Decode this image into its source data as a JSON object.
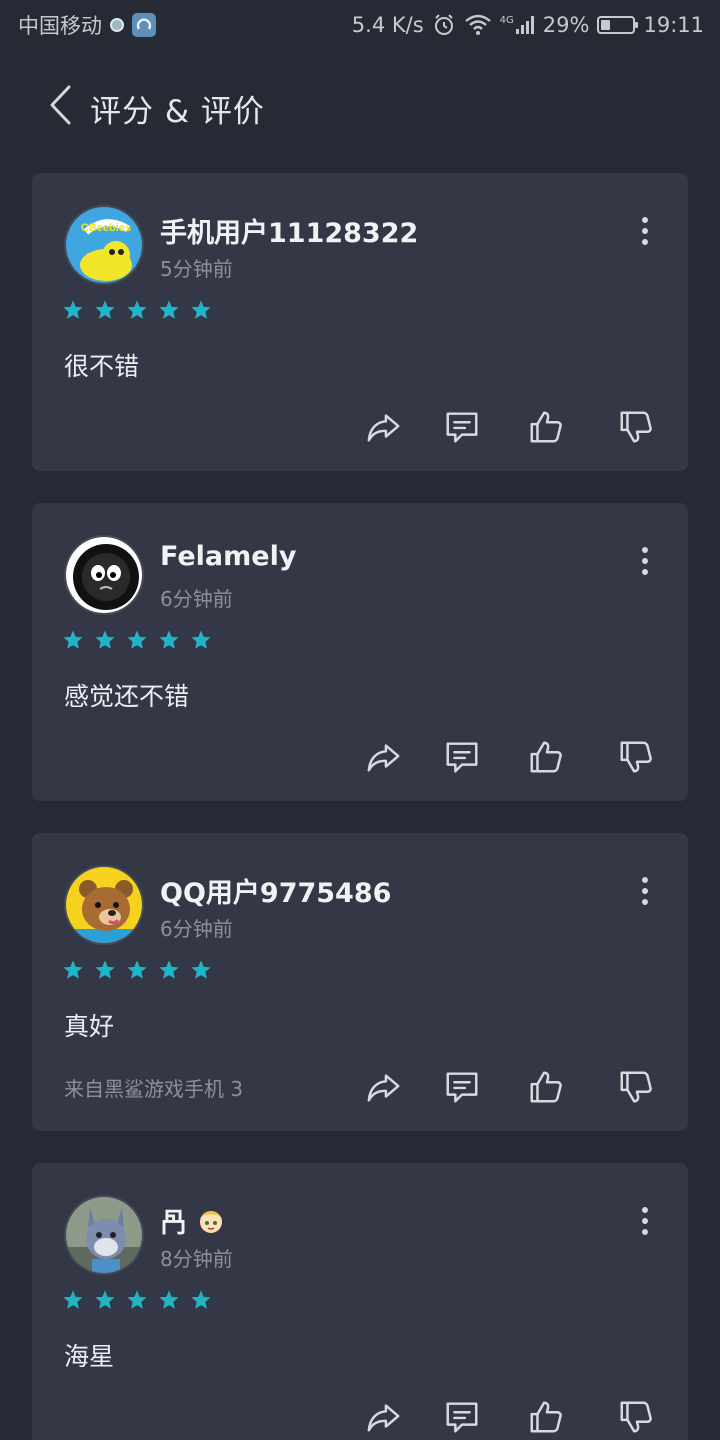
{
  "status_bar": {
    "carrier": "中国移动",
    "speed": "5.4 K/s",
    "network": "4G",
    "battery": "29%",
    "time": "19:11"
  },
  "header": {
    "title": "评分 & 评价"
  },
  "reviews": [
    {
      "username": "手机用户11128322",
      "time": "5分钟前",
      "rating": 5,
      "text": "很不错",
      "source": ""
    },
    {
      "username": "Felamely",
      "time": "6分钟前",
      "rating": 5,
      "text": "感觉还不错",
      "source": ""
    },
    {
      "username": "QQ用户9775486",
      "time": "6分钟前",
      "rating": 5,
      "text": "真好",
      "source": "来自黑鲨游戏手机 3"
    },
    {
      "username": "冎",
      "time": "8分钟前",
      "rating": 5,
      "text": "海星",
      "source": ""
    }
  ],
  "avatar_texts": {
    "cbeebies": "CBeebies"
  },
  "colors": {
    "background": "#262a34",
    "card": "#343846",
    "star": "#1fb5c9",
    "secondary_text": "#8d909b"
  },
  "icons": [
    "back-arrow-icon",
    "more-vertical-icon",
    "star-icon",
    "share-icon",
    "comment-icon",
    "thumbs-up-icon",
    "thumbs-down-icon"
  ]
}
